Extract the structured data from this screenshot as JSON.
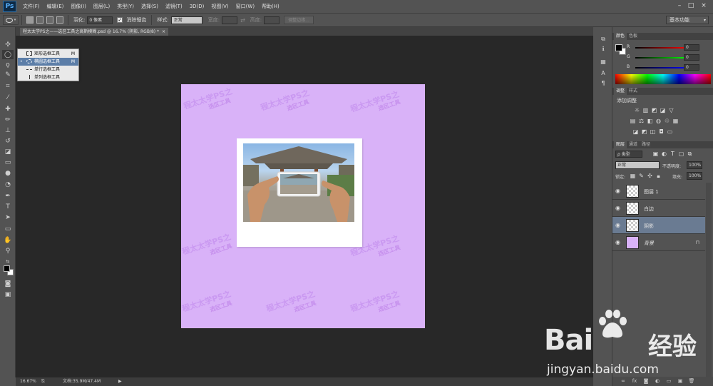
{
  "app": {
    "logo": "Ps"
  },
  "menu": [
    "文件(F)",
    "编辑(E)",
    "图像(I)",
    "图层(L)",
    "类型(Y)",
    "选择(S)",
    "滤镜(T)",
    "3D(D)",
    "视图(V)",
    "窗口(W)",
    "帮助(H)"
  ],
  "options": {
    "feather_label": "羽化:",
    "feather_value": "0 像素",
    "antialias_label": "消除锯齿",
    "style_label": "样式:",
    "style_value": "正常",
    "width_label": "宽度:",
    "height_label": "高度:",
    "refine_edge": "调整边缘...",
    "workspace": "基本功能"
  },
  "document": {
    "tab_title": "程太太学PS之——选区工具之高斯模糊.psd @ 16.7% (阴影, RGB/8) *",
    "watermark_1": "程太太学PS之",
    "watermark_2": "选区工具"
  },
  "flyout": {
    "items": [
      {
        "label": "矩形选框工具",
        "key": "M"
      },
      {
        "label": "椭圆选框工具",
        "key": "M"
      },
      {
        "label": "单行选框工具",
        "key": ""
      },
      {
        "label": "单列选框工具",
        "key": ""
      }
    ]
  },
  "status": {
    "zoom": "16.67%",
    "doc": "文档:35.9M/47.4M"
  },
  "color_panel": {
    "tabs": [
      "颜色",
      "色板"
    ],
    "r_label": "R",
    "g_label": "G",
    "b_label": "B",
    "r_value": "0",
    "g_value": "0",
    "b_value": "0"
  },
  "adjust_panel": {
    "tabs": [
      "调整",
      "样式"
    ],
    "title": "添加调整"
  },
  "layers_panel": {
    "tabs": [
      "图层",
      "通道",
      "路径"
    ],
    "filter": "ρ 类型",
    "blend_mode": "正常",
    "opacity_label": "不透明度:",
    "opacity_value": "100%",
    "lock_label": "锁定:",
    "fill_label": "填充:",
    "fill_value": "100%",
    "layers": [
      {
        "name": "图层 1"
      },
      {
        "name": "白边"
      },
      {
        "name": "阴影"
      },
      {
        "name": "背景"
      }
    ]
  },
  "watermark": {
    "brand": "Bai",
    "brand_cn": "经验",
    "url": "jingyan.baidu.com"
  }
}
